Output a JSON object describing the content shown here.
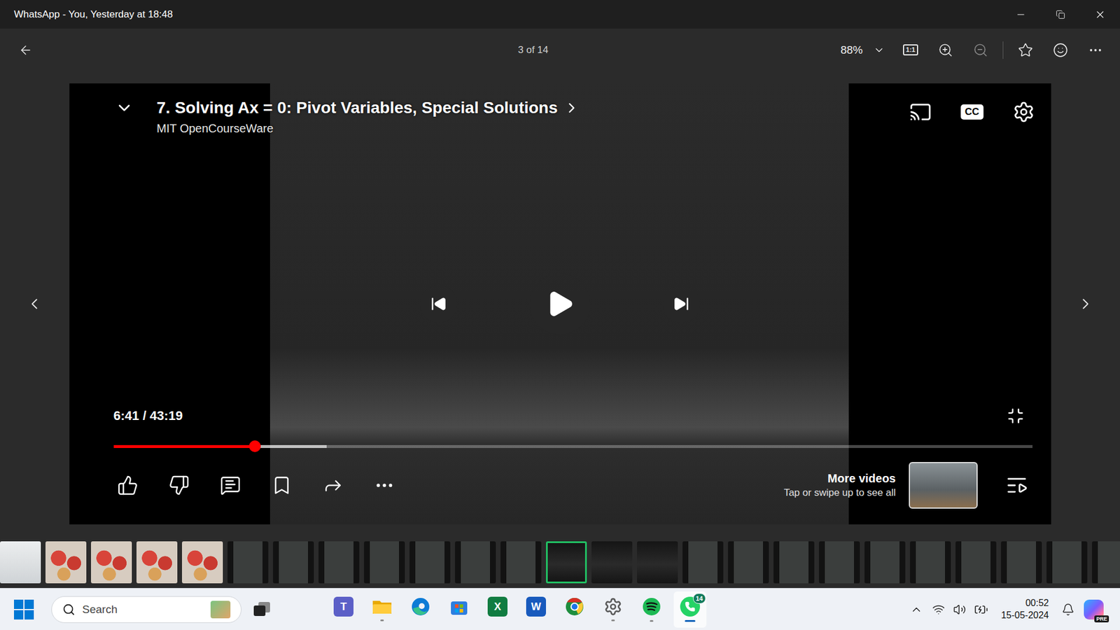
{
  "window": {
    "title": "WhatsApp - You, Yesterday at 18:48"
  },
  "toolbar": {
    "counter": "3 of 14",
    "zoom": "88%",
    "actual_size": "1:1"
  },
  "video": {
    "title": "7. Solving Ax = 0: Pivot Variables, Special Solutions",
    "channel": "MIT OpenCourseWare",
    "captions": "CC",
    "time": "6:41 / 43:19",
    "playing": false,
    "progress": {
      "level": 0.154,
      "buffered": 0.232
    },
    "more_videos": {
      "title": "More videos",
      "hint": "Tap or swipe up to see all"
    }
  },
  "thumbnails": [
    {
      "kind": "receipt",
      "selected": false
    },
    {
      "kind": "photo",
      "selected": false
    },
    {
      "kind": "photo",
      "selected": false
    },
    {
      "kind": "photo",
      "selected": false
    },
    {
      "kind": "photo",
      "selected": false
    },
    {
      "kind": "board",
      "selected": false
    },
    {
      "kind": "board",
      "selected": false
    },
    {
      "kind": "board",
      "selected": false
    },
    {
      "kind": "board",
      "selected": false
    },
    {
      "kind": "board",
      "selected": false
    },
    {
      "kind": "board",
      "selected": false
    },
    {
      "kind": "board",
      "selected": false
    },
    {
      "kind": "video",
      "selected": true
    },
    {
      "kind": "video",
      "selected": false
    },
    {
      "kind": "video",
      "selected": false
    },
    {
      "kind": "board",
      "selected": false
    },
    {
      "kind": "board",
      "selected": false
    },
    {
      "kind": "board",
      "selected": false
    },
    {
      "kind": "board",
      "selected": false
    },
    {
      "kind": "board",
      "selected": false
    },
    {
      "kind": "board",
      "selected": false
    },
    {
      "kind": "board",
      "selected": false
    },
    {
      "kind": "board",
      "selected": false
    },
    {
      "kind": "board",
      "selected": false
    },
    {
      "kind": "board",
      "selected": false
    }
  ],
  "taskbar": {
    "search": {
      "placeholder": "Search"
    },
    "apps": [
      {
        "kind": "teams",
        "glyph": "T",
        "running": false,
        "active": false
      },
      {
        "kind": "explorer",
        "running": true,
        "active": false
      },
      {
        "kind": "edge",
        "running": false,
        "active": false
      },
      {
        "kind": "store",
        "running": false,
        "active": false
      },
      {
        "kind": "excel",
        "glyph": "X",
        "running": false,
        "active": false
      },
      {
        "kind": "word",
        "glyph": "W",
        "running": false,
        "active": false
      },
      {
        "kind": "chrome",
        "running": false,
        "active": false
      },
      {
        "kind": "settings",
        "running": true,
        "active": false
      },
      {
        "kind": "spotify",
        "running": true,
        "active": false
      },
      {
        "kind": "whatsapp",
        "running": true,
        "active": true,
        "badge": "14"
      }
    ],
    "clock": {
      "time": "00:52",
      "date": "15-05-2024"
    },
    "copilot_badge": "PRE"
  }
}
